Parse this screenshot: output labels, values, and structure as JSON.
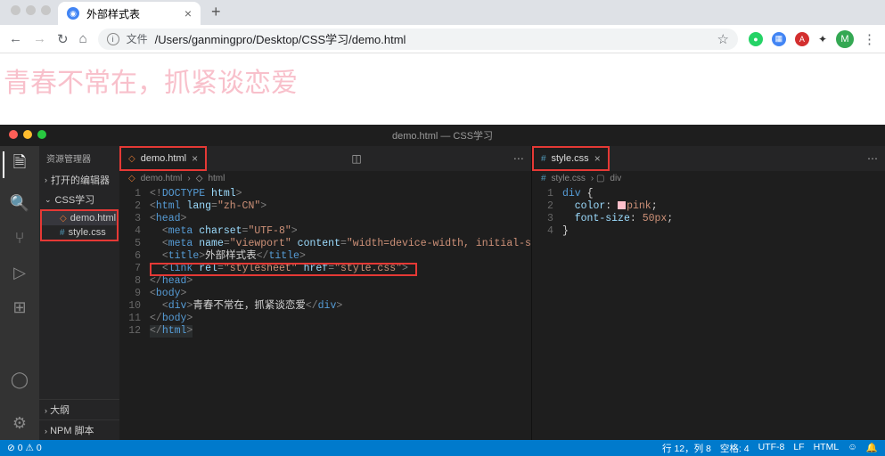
{
  "browser": {
    "tab_title": "外部样式表",
    "url_label": "文件",
    "url_path": "/Users/ganmingpro/Desktop/CSS学习/demo.html",
    "avatar_letter": "M"
  },
  "page": {
    "text": "青春不常在，抓紧谈恋爱"
  },
  "vscode": {
    "title": "demo.html — CSS学习",
    "explorer_title": "资源管理器",
    "sections": {
      "open_editors": "打开的编辑器",
      "project": "CSS学习",
      "outline": "大纲",
      "npm": "NPM 脚本"
    },
    "files": [
      "demo.html",
      "style.css"
    ],
    "left_editor": {
      "tab": "demo.html",
      "crumb": [
        "demo.html",
        "html"
      ],
      "lines": [
        "<!DOCTYPE html>",
        "<html lang=\"zh-CN\">",
        "<head>",
        "  <meta charset=\"UTF-8\">",
        "  <meta name=\"viewport\" content=\"width=device-width, initial-s",
        "  <title>外部样式表</title>",
        "  <link rel=\"stylesheet\" href=\"style.css\">",
        "</head>",
        "<body>",
        "  <div>青春不常在，抓紧谈恋爱</div>",
        "</body>",
        "</html>"
      ]
    },
    "right_editor": {
      "tab": "style.css",
      "crumb": [
        "style.css",
        "div"
      ],
      "lines": [
        "div {",
        "  color: pink;",
        "  font-size: 50px;",
        "}"
      ]
    },
    "status": {
      "errors": "0",
      "warnings": "0",
      "pos": "行 12，列 8",
      "spaces": "空格: 4",
      "enc": "UTF-8",
      "eol": "LF",
      "lang": "HTML"
    }
  }
}
